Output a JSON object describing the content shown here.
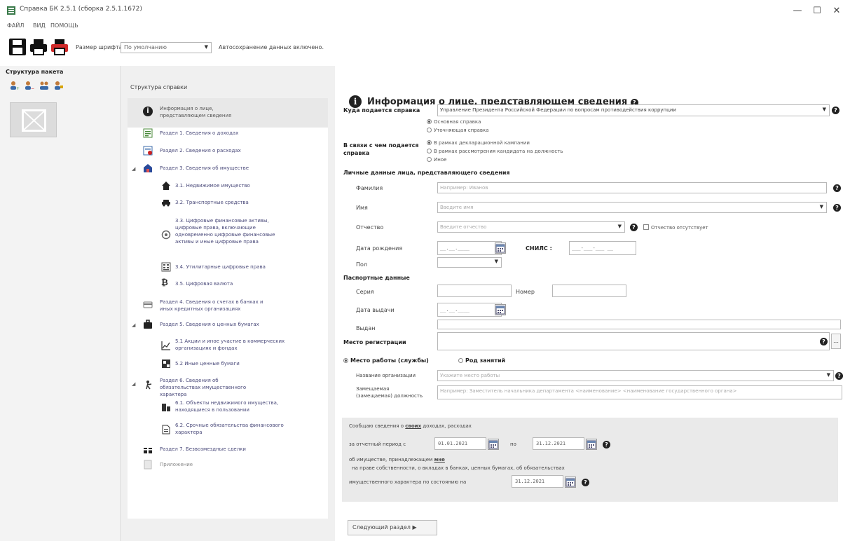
{
  "window": {
    "title": "Справка БК 2.5.1 (сборка 2.5.1.1672)",
    "minimize": "—",
    "maximize": "☐",
    "close": "✕"
  },
  "menu": [
    "ФАЙЛ",
    "ВИД",
    "ПОМОЩЬ"
  ],
  "toolbar": {
    "font_size_label": "Размер шрифта",
    "font_size_value": "По умолчанию",
    "autosave_text": "Автосохранение данных включено."
  },
  "left_panel": {
    "title": "Структура пакета"
  },
  "mid_panel": {
    "title": "Структура справки",
    "items": [
      {
        "label": "Информация о лице, представляющем сведения",
        "icon": "info-icon"
      },
      {
        "label": "Раздел 1. Сведения о доходах",
        "icon": "income-icon"
      },
      {
        "label": "Раздел 2. Сведения о расходах",
        "icon": "expense-icon"
      },
      {
        "label": "Раздел 3. Сведения об имуществе",
        "icon": "property-icon"
      },
      {
        "label": "3.1. Недвижимое имущество",
        "icon": "house-icon"
      },
      {
        "label": "3.2. Транспортные средства",
        "icon": "car-icon"
      },
      {
        "label": "3.3. Цифровые финансовые активы, цифровые права, включающие одновременно цифровые финансовые активы и иные цифровые права",
        "icon": "digital-assets-icon"
      },
      {
        "label": "3.4. Утилитарные цифровые права",
        "icon": "utility-rights-icon"
      },
      {
        "label": "3.5. Цифровая валюта",
        "icon": "bitcoin-icon"
      },
      {
        "label": "Раздел 4. Сведения о счетах в банках и иных кредитных организациях",
        "icon": "bank-card-icon"
      },
      {
        "label": "Раздел 5. Сведения о ценных бумагах",
        "icon": "briefcase-icon"
      },
      {
        "label": "5.1 Акции и иное участие в коммерческих организациях и фондах",
        "icon": "chart-line-icon"
      },
      {
        "label": "5.2 Иные ценные бумаги",
        "icon": "securities-icon"
      },
      {
        "label": "Раздел 6. Сведения об обязательствах имущественного характера",
        "icon": "obligations-icon"
      },
      {
        "label": "6.1. Объекты недвижимого имущества, находящиеся в пользовании",
        "icon": "buildings-icon"
      },
      {
        "label": "6.2. Срочные обязательства финансового характера",
        "icon": "document-icon"
      },
      {
        "label": "Раздел 7. Безвозмездные сделки",
        "icon": "gift-icon"
      },
      {
        "label": "Приложение",
        "icon": "attachment-icon"
      }
    ]
  },
  "form": {
    "header": "Информация о лице, представляющем сведения",
    "where_label": "Куда подается справка",
    "where_value": "Управление Президента Российской Федерации по вопросам противодействия коррупции",
    "type_options": [
      "Основная справка",
      "Уточняющая справка"
    ],
    "reason_label": "В связи с чем подается справка",
    "reason_options": [
      "В рамках декларационной кампании",
      "В рамках рассмотрения кандидата на должность",
      "Иное"
    ],
    "personal_title": "Личные данные лица, представляющего сведения",
    "surname_label": "Фамилия",
    "surname_placeholder": "Например: Иванов",
    "name_label": "Имя",
    "name_placeholder": "Введите имя",
    "patronymic_label": "Отчество",
    "patronymic_placeholder": "Введите отчество",
    "no_patronymic": "Отчество отсутствует",
    "birth_label": "Дата рождения",
    "date_mask": "__.__.____",
    "snils_label": "СНИЛС :",
    "snils_mask": "___-___-___ __",
    "sex_label": "Пол",
    "passport_title": "Паспортные данные",
    "series_label": "Серия",
    "number_label": "Номер",
    "issue_date_label": "Дата выдачи",
    "issued_by_label": "Выдан",
    "registration_label": "Место регистрации",
    "work_option": "Место работы (службы)",
    "occupation_option": "Род занятий",
    "org_label": "Название организации",
    "org_placeholder": "Укажите место работы",
    "position_label": "Замещаемая (замещаемая) должность",
    "position_placeholder": "Например: Заместитель начальника департамента <наименование> <наименование государственного органа>",
    "report_text": "Сообщаю сведения о",
    "report_link": "своих",
    "report_text2": "доходах, расходах",
    "period_label": "за отчетный период с",
    "period_from": "01.01.2021",
    "period_to_label": "по",
    "period_to": "31.12.2021",
    "property_text": "об имуществе, принадлежащем",
    "property_link": "мне",
    "property_text2": "на праве собственности, о вкладах в банках, ценных бумагах, об обязательствах",
    "asof_label": "имущественного характера по состоянию на",
    "asof_date": "31.12.2021",
    "next_button": "Следующий раздел ▶"
  }
}
